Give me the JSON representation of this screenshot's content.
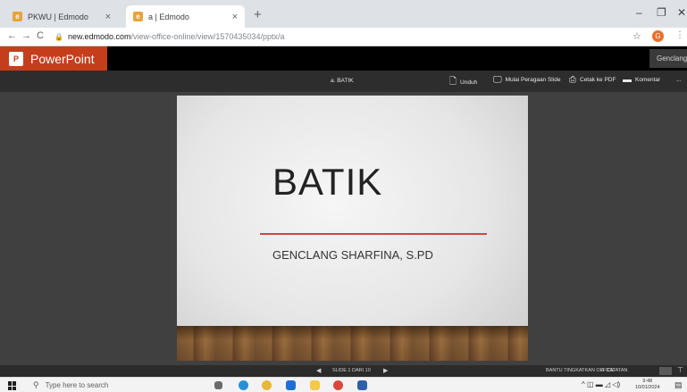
{
  "browser": {
    "tabs": [
      {
        "title": "PKWU | Edmodo",
        "favicon": "edmodo-icon",
        "active": false
      },
      {
        "title": "a | Edmodo",
        "favicon": "edmodo-icon",
        "active": true
      }
    ],
    "new_tab_glyph": "+",
    "close_glyph": "×",
    "window_controls": {
      "minimize": "–",
      "maximize": "❐",
      "close": "✕"
    },
    "nav": {
      "back": "←",
      "forward": "→",
      "reload": "C"
    },
    "url_host": "new.edmodo.com",
    "url_path": "/view-office-online/view/1570435034/pptx/a",
    "profile_initial": "G"
  },
  "app": {
    "name": "PowerPoint",
    "logo_letter": "P",
    "user_name": "Genclang",
    "accent_color": "#c43e1c"
  },
  "toolbar": {
    "doc_title": "a. BATIK",
    "buttons": [
      {
        "label": "Unduh",
        "icon": "download-icon"
      },
      {
        "label": "Mulai Peragaan Slide",
        "icon": "slideshow-icon"
      },
      {
        "label": "Cetak ke PDF",
        "icon": "print-icon"
      },
      {
        "label": "Komentar",
        "icon": "comment-icon"
      }
    ],
    "more": "..."
  },
  "slide": {
    "title": "BATIK",
    "subtitle": "GENCLANG SHARFINA, S.PD",
    "line_color": "#d2453f"
  },
  "statusbar": {
    "slide_indicator": "SLIDE 1 DARI 10",
    "help": "BANTU TINGKATKAN OFFICE",
    "notes": "CATATAN"
  },
  "taskbar": {
    "search_placeholder": "Type here to search",
    "clock_time": "9:48",
    "clock_date": "10/01/2024"
  }
}
